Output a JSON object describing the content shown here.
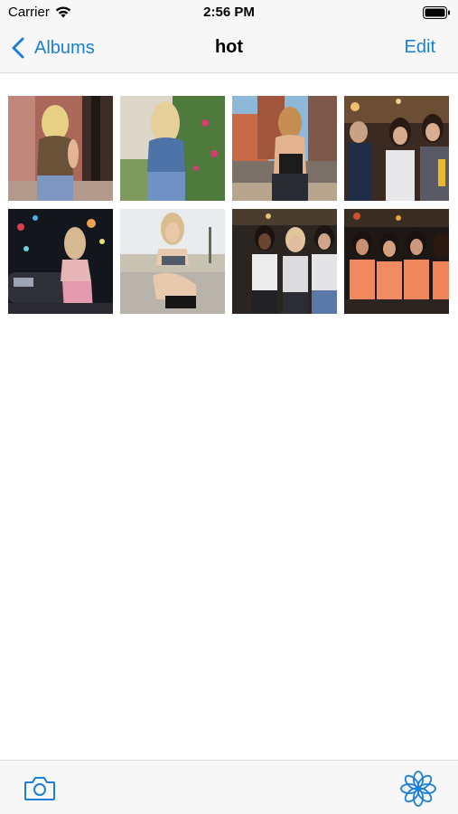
{
  "status_bar": {
    "carrier": "Carrier",
    "time": "2:56 PM",
    "icons": [
      "wifi-icon",
      "battery-icon"
    ]
  },
  "nav": {
    "back_label": "Albums",
    "title": "hot",
    "edit_label": "Edit"
  },
  "accent_color": "#1a7fd9",
  "photos": [
    {
      "name": "photo-1",
      "scene": "blonde woman in brown top by brick wall"
    },
    {
      "name": "photo-2",
      "scene": "blonde woman in denim by green bushes"
    },
    {
      "name": "photo-3",
      "scene": "woman in black top on street with buildings"
    },
    {
      "name": "photo-4",
      "scene": "group of women at night club"
    },
    {
      "name": "photo-5",
      "scene": "woman by car at night with city lights"
    },
    {
      "name": "photo-6",
      "scene": "woman sitting on beach road"
    },
    {
      "name": "photo-7",
      "scene": "three women posing in bar"
    },
    {
      "name": "photo-8",
      "scene": "women in orange tank tops at restaurant"
    }
  ],
  "toolbar": {
    "left_icon": "camera-icon",
    "right_icon": "flower-icon"
  }
}
